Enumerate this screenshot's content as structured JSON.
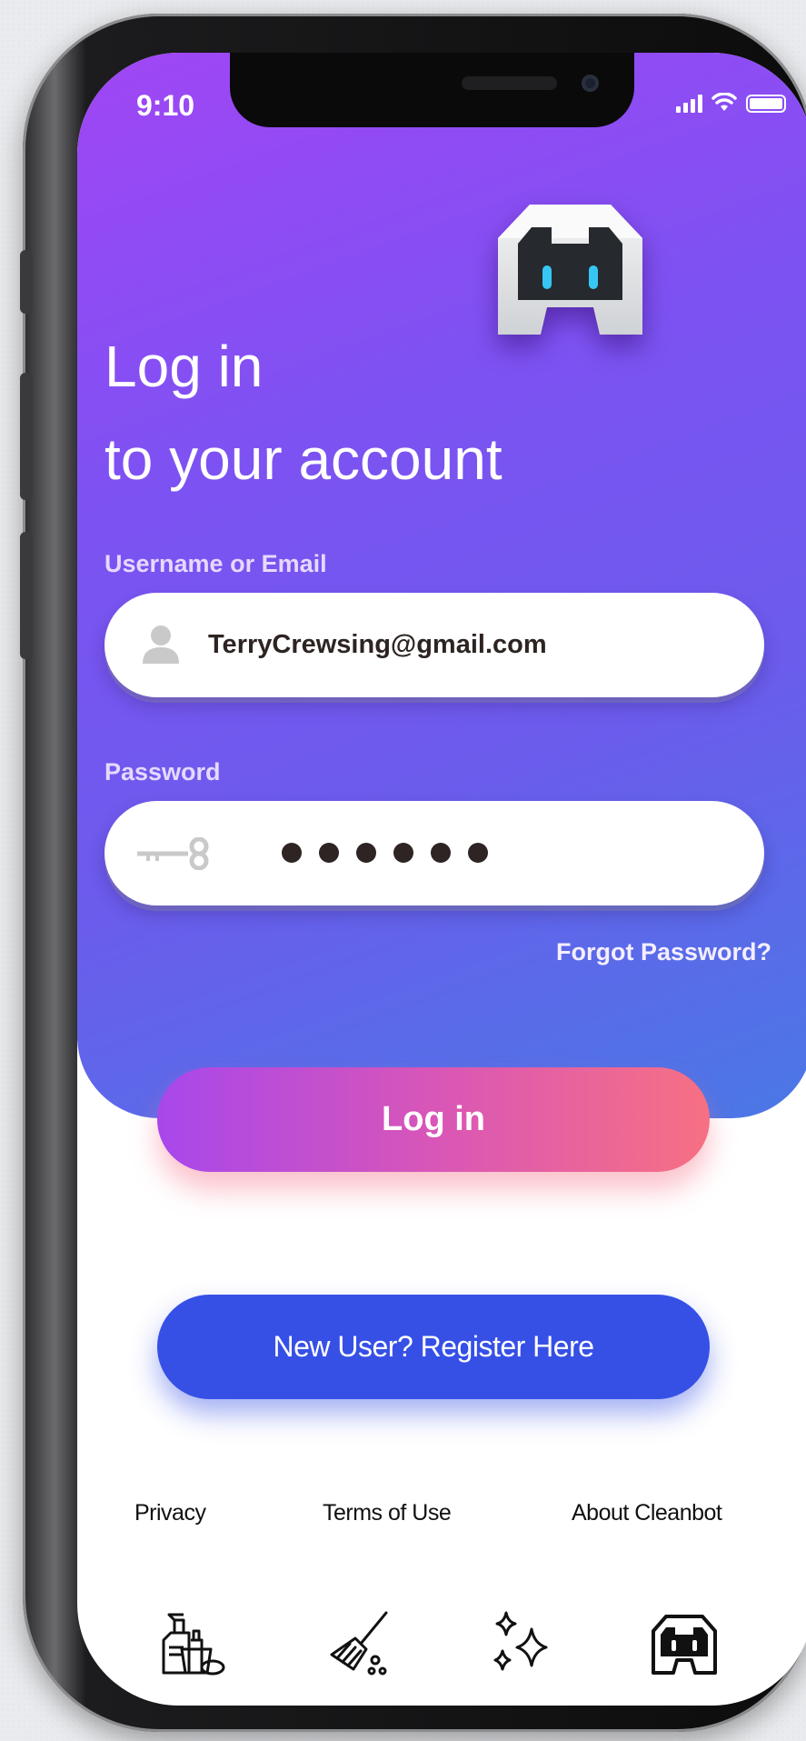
{
  "status_bar": {
    "time": "9:10"
  },
  "login": {
    "title_line1": "Log in",
    "title_line2": "to your account",
    "username_label": "Username or Email",
    "username_value": "TerryCrewsing@gmail.com",
    "password_label": "Password",
    "password_masked_length": 6,
    "forgot_password": "Forgot Password?",
    "login_button": "Log in",
    "register_button": "New User?  Register Here"
  },
  "footer": {
    "links": [
      "Privacy",
      "Terms of Use",
      "About Cleanbot"
    ]
  },
  "tab_bar": {
    "icons": [
      "cleaning-supplies-icon",
      "broom-icon",
      "sparkles-icon",
      "cleanbot-logo-icon"
    ]
  },
  "colors": {
    "hero_gradient_start": "#a046f5",
    "hero_gradient_end": "#4a78e6",
    "login_gradient_start": "#a847ec",
    "login_gradient_end": "#f77083",
    "register_button": "#3650e6"
  }
}
